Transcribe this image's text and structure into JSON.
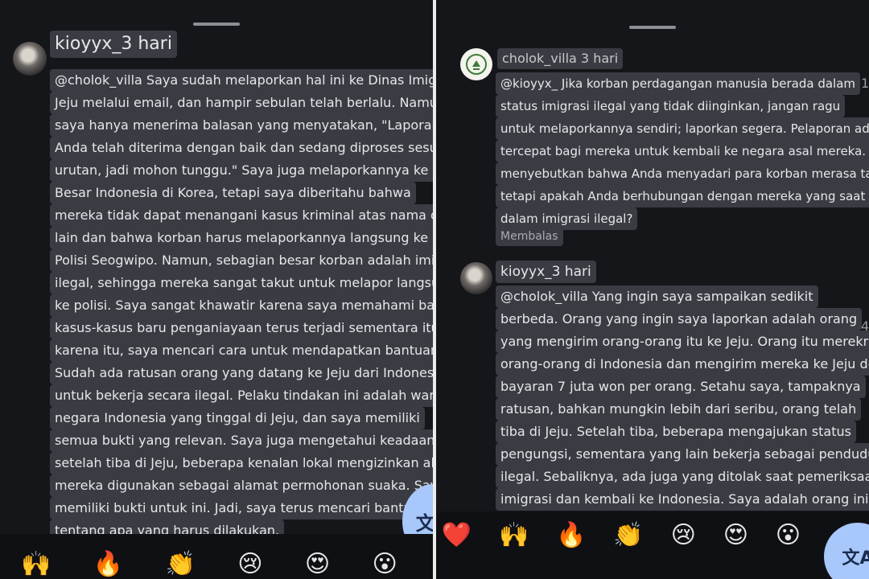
{
  "left": {
    "username_time": "kioyyx_3 hari",
    "comment_lines": [
      "@cholok_villa Saya sudah melaporkan hal ini ke Dinas Imigrasi",
      "Jeju melalui email, dan hampir sebulan telah berlalu. Namun,",
      "saya hanya menerima balasan yang menyatakan, \"Laporan",
      "Anda telah diterima dengan baik dan sedang diproses sesuai",
      "urutan, jadi mohon tunggu.\" Saya juga melaporkannya ke Kedutaan",
      "Besar Indonesia di Korea, tetapi saya diberitahu bahwa",
      "mereka tidak dapat menangani kasus kriminal atas nama orang",
      "lain dan bahwa korban harus melaporkannya langsung ke Kantor",
      "Polisi Seogwipo. Namun, sebagian besar korban adalah imigran",
      "ilegal, sehingga mereka sangat takut untuk melapor langsung",
      "ke polisi. Saya sangat khawatir karena saya memahami bahwa",
      "kasus-kasus baru penganiayaan terus terjadi sementara itu. Oleh",
      "karena itu, saya mencari cara untuk mendapatkan bantuan.",
      "Sudah ada ratusan orang yang datang ke Jeju dari Indonesia",
      "untuk bekerja secara ilegal. Pelaku tindakan ini adalah warga",
      "negara Indonesia yang tinggal di Jeju, dan saya memiliki",
      "semua bukti yang relevan. Saya juga mengetahui keadaan di mana,",
      "setelah tiba di Jeju, beberapa kenalan lokal mengizinkan alamat",
      "mereka digunakan sebagai alamat permohonan suaka. Saya juga",
      "memiliki bukti untuk ini. Jadi, saya terus mencari bantuan",
      "tentang apa yang harus dilakukan."
    ],
    "emojis": [
      "🙌",
      "🔥",
      "👏",
      "😢",
      "😍",
      "😮"
    ]
  },
  "right": {
    "reply1_username_time": "cholok_villa 3 hari",
    "reply1_lines": [
      "@kioyyx_ Jika korban perdagangan manusia berada dalam",
      "status imigrasi ilegal yang tidak diinginkan, jangan ragu",
      "untuk melaporkannya sendiri; laporkan segera. Pelaporan adalah cara",
      "tercepat bagi mereka untuk kembali ke negara asal mereka. Anda",
      "menyebutkan bahwa Anda menyadari para korban merasa takut,",
      "tetapi apakah Anda berhubungan dengan mereka yang saat ini berada",
      "dalam imigrasi ilegal?"
    ],
    "reply_button": "Membalas",
    "reply2_username_time": "kioyyx_3 hari",
    "reply2_lines": [
      "@cholok_villa Yang ingin saya sampaikan sedikit",
      "berbeda. Orang yang ingin saya laporkan adalah orang",
      "yang mengirim orang-orang itu ke Jeju. Orang itu merekrut",
      "orang-orang di Indonesia dan mengirim mereka ke Jeju dengan",
      "bayaran 7 juta won per orang. Setahu saya, tampaknya",
      "ratusan, bahkan mungkin lebih dari seribu, orang telah",
      "tiba di Jeju. Setelah tiba, beberapa mengajukan status",
      "pengungsi, sementara yang lain bekerja sebagai penduduk",
      "ilegal. Sebaliknya, ada juga yang ditolak saat pemeriksaan",
      "imigrasi dan kembali ke Indonesia. Saya adalah orang ini."
    ],
    "emojis": [
      "❤️",
      "🙌",
      "🔥",
      "👏",
      "😢",
      "😍",
      "😮"
    ]
  },
  "translate_glyph": "文A",
  "side_marks": [
    "1",
    "4"
  ],
  "colors": {
    "highlight": "#3a3c43",
    "translate": "#a8c7fa",
    "background": "#15161a"
  }
}
